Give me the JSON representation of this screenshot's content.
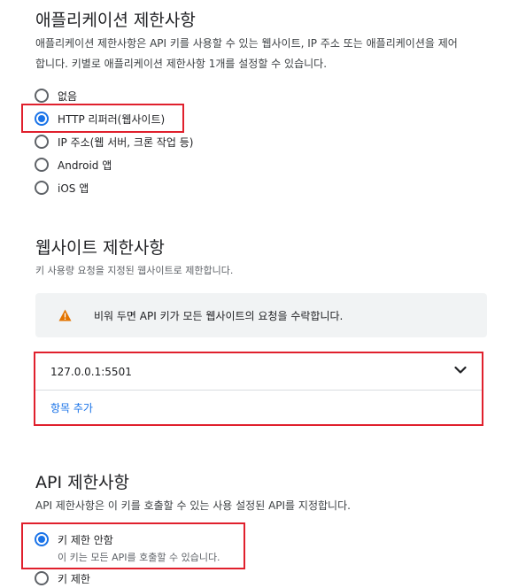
{
  "app_restrictions": {
    "title": "애플리케이션 제한사항",
    "description_line1": "애플리케이션 제한사항은 API 키를 사용할 수 있는 웹사이트, IP 주소 또는 애플리케이션을 제어",
    "description_line2": "합니다. 키별로 애플리케이션 제한사항 1개를 설정할 수 있습니다.",
    "options": [
      {
        "label": "없음",
        "selected": false
      },
      {
        "label": "HTTP 리퍼러(웹사이트)",
        "selected": true
      },
      {
        "label": "IP 주소(웹 서버, 크론 작업 등)",
        "selected": false
      },
      {
        "label": "Android 앱",
        "selected": false
      },
      {
        "label": "iOS 앱",
        "selected": false
      }
    ]
  },
  "website_restrictions": {
    "title": "웹사이트 제한사항",
    "description": "키 사용량 요청을 지정된 웹사이트로 제한합니다.",
    "warning": "비워 두면 API 키가 모든 웹사이트의 요청을 수락합니다.",
    "item_value": "127.0.0.1:5501",
    "add_item_label": "항목 추가"
  },
  "api_restrictions": {
    "title": "API 제한사항",
    "description": "API 제한사항은 이 키를 호출할 수 있는 사용 설정된 API를 지정합니다.",
    "options": [
      {
        "label": "키 제한 안함",
        "sublabel": "이 키는 모든 API를 호출할 수 있습니다.",
        "selected": true
      },
      {
        "label": "키 제한",
        "selected": false
      }
    ]
  },
  "colors": {
    "accent": "#1a73e8",
    "highlight": "#e0202d",
    "warning": "#e37400"
  }
}
